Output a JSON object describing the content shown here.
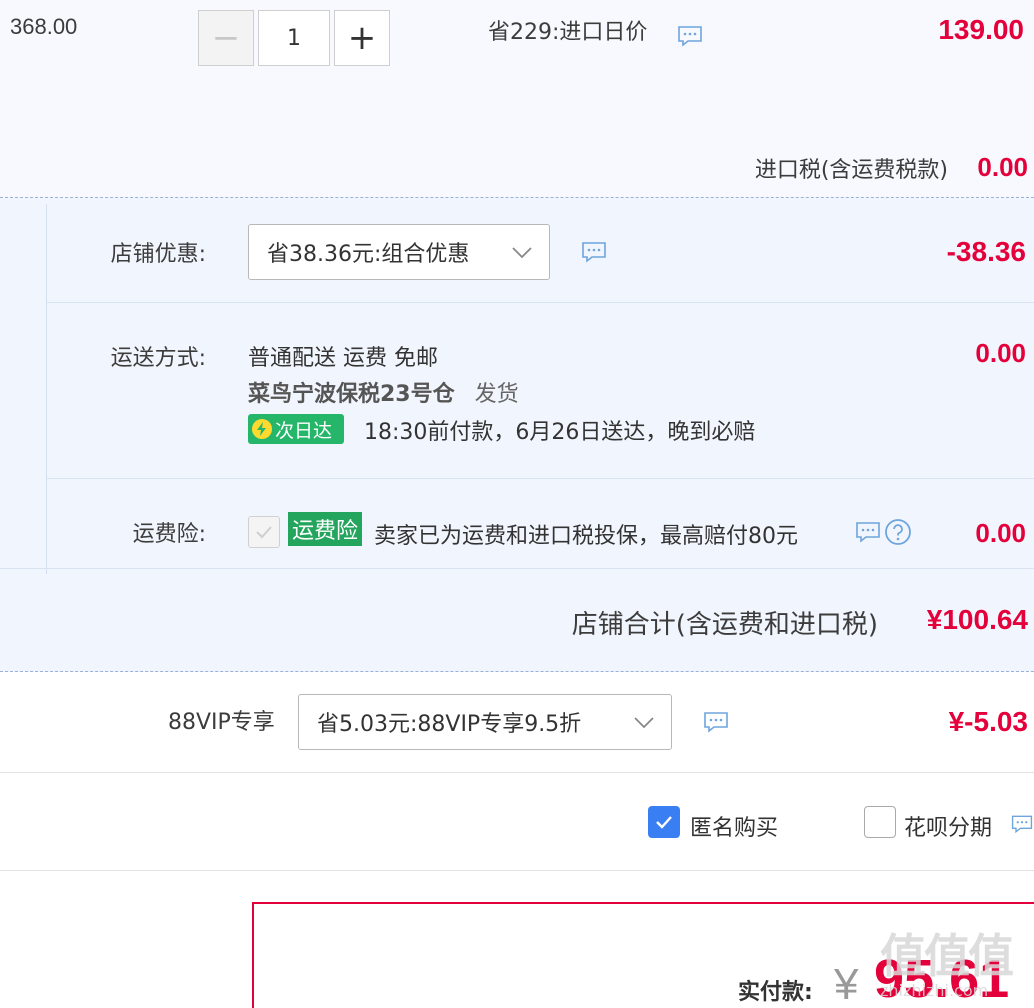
{
  "item": {
    "original_price": "368.00",
    "quantity": "1",
    "minus_label": "−",
    "plus_label": "+",
    "promo": "省229:进口日价",
    "price": "139.00",
    "tax_label": "进口税(含运费税款)",
    "tax_value": "0.00"
  },
  "shop": {
    "discount_label": "店铺优惠:",
    "discount_selected": "省38.36元:组合优惠",
    "discount_value": "-38.36",
    "shipping_label": "运送方式:",
    "shipping_method": "普通配送 运费 免邮",
    "warehouse": "菜鸟宁波保税23号仓",
    "ship_from": "发货",
    "next_day_badge": "次日达",
    "delivery_promise": "18:30前付款，6月26日送达，晚到必赔",
    "shipping_value": "0.00",
    "insurance_label": "运费险:",
    "insurance_badge": "运费险",
    "insurance_text": "卖家已为运费和进口税投保，最高赔付80元",
    "insurance_value": "0.00",
    "total_label": "店铺合计(含运费和进口税)",
    "total_value": "¥100.64"
  },
  "vip": {
    "label": "88VIP专享",
    "selected": "省5.03元:88VIP专享9.5折",
    "value": "¥-5.03"
  },
  "options": {
    "anonymous_label": "匿名购买",
    "anonymous_checked": true,
    "huabei_label": "花呗分期",
    "huabei_checked": false
  },
  "payment": {
    "label": "实付款:",
    "currency": "¥",
    "amount": "95.61"
  },
  "watermark": {
    "text": "值值值",
    "site": "zhizhizhi.com"
  },
  "colors": {
    "price_red": "#e4003a",
    "accent_blue": "#3a7ef3",
    "badge_green": "#25b66a",
    "section_bg": "#f1f5fd"
  }
}
